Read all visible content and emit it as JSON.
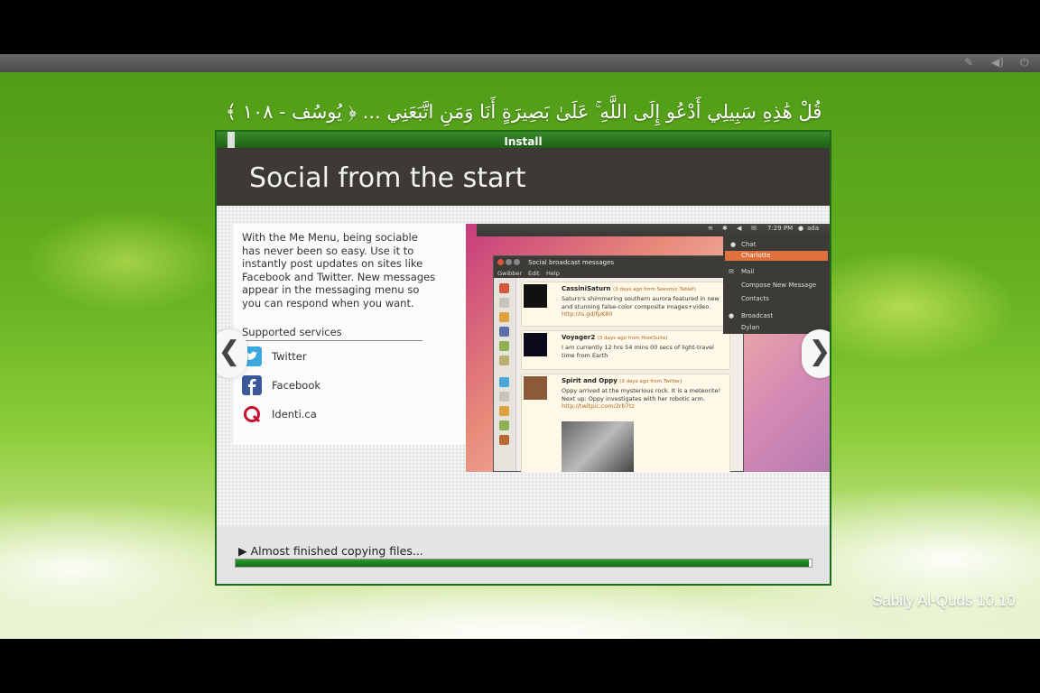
{
  "verse": "قُلْ هَٰذِهِ سَبِيلِي أَدْعُو إِلَى اللَّهِ ۚ عَلَىٰ بَصِيرَةٍ أَنَا وَمَنِ اتَّبَعَنِي ... ﴿ يُوسُف - ١٠٨ ﴾",
  "brand": "Sabily Al-Quds 10.10",
  "window": {
    "title": "Install",
    "heading": "Social from the start",
    "description": "With the Me Menu, being sociable has never been so easy. Use it to instantly post updates on sites like Facebook and Twitter. New messages appear in the messaging menu so you can respond when you want.",
    "services_heading": "Supported services",
    "services": [
      {
        "label": "Twitter",
        "icon": "twitter-icon",
        "color": "#3aa9de"
      },
      {
        "label": "Facebook",
        "icon": "facebook-icon",
        "color": "#3b5998"
      },
      {
        "label": "Identi.ca",
        "icon": "identica-icon",
        "color": "#c8102e"
      }
    ],
    "prev_arrow": "❮",
    "next_arrow": "❯",
    "progress": {
      "label": "Almost finished copying files...",
      "expander": "▶",
      "fraction": 0.995
    }
  },
  "screenshot": {
    "panel_time": "7:29 PM",
    "panel_user": "ada",
    "menu": [
      "Chat",
      "Charlotte",
      "Mail",
      "Compose New Message",
      "Contacts",
      "Broadcast",
      "Dylan"
    ],
    "app_title": "Social broadcast messages",
    "app_menu": [
      "Gwibber",
      "Edit",
      "Help"
    ],
    "messages": [
      {
        "name": "CassiniSaturn",
        "meta": "(3 days ago from Seesmic Tablet)",
        "body": "Saturn's shimmering southern aurora featured in new and stunning false-color composite images+video.",
        "link": "http://is.gd/fpK80"
      },
      {
        "name": "Voyager2",
        "meta": "(3 days ago from HootSuite)",
        "body": "I am currently 12 hrs 54 mins 00 secs of light-travel time from Earth",
        "link": ""
      },
      {
        "name": "Spirit and Oppy",
        "meta": "(3 days ago from Twitter)",
        "body": "Oppy arrived at the mysterious rock. It is a meteorite! Next up: Oppy investigates with her robotic arm.",
        "link": "http://twitpic.com/2rb7tz"
      }
    ]
  },
  "colors": {
    "accent_green": "#1d5e16",
    "progress_green": "#0e6b14",
    "banner_dark": "#3d3a36",
    "menu_highlight": "#e0713d"
  }
}
